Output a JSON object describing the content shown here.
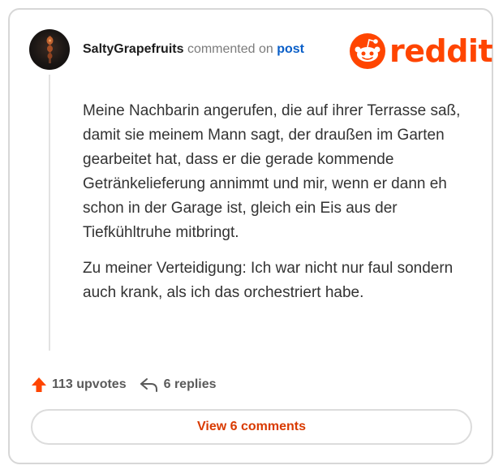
{
  "header": {
    "username": "SaltyGrapefruits",
    "action_text": "commented on",
    "link_text": "post",
    "brand": "reddit",
    "avatar_icon": "user-avatar-icon"
  },
  "comment": {
    "paragraphs": [
      "Meine Nachbarin angerufen, die auf ihrer Terrasse saß, damit sie meinem Mann sagt, der draußen im Garten gearbeitet hat, dass er die gerade kommende Getränkelieferung annimmt und mir, wenn er dann eh schon in der Garage ist, gleich ein Eis aus der Tiefkühltruhe mitbringt.",
      "Zu meiner Verteidigung: Ich war nicht nur faul sondern auch krank, als ich das orchestriert habe."
    ]
  },
  "footer": {
    "upvotes_label": "113 upvotes",
    "replies_label": "6 replies",
    "view_button_label": "View 6 comments"
  },
  "colors": {
    "brand_orange": "#ff4500",
    "link_blue": "#0a5fc8",
    "button_text": "#d93a00",
    "border": "#d7d7d7"
  }
}
